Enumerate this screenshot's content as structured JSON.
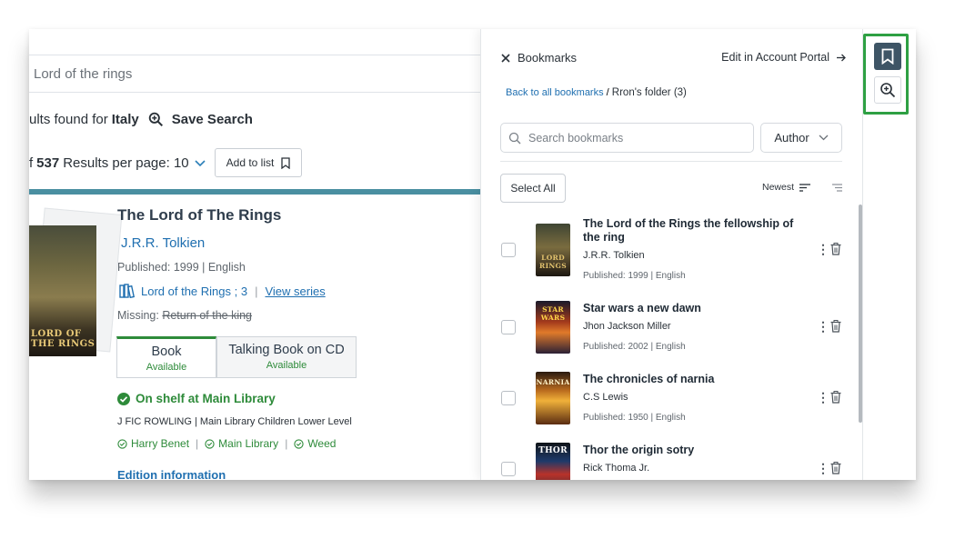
{
  "search": {
    "value": "Lord of the rings"
  },
  "results": {
    "found_prefix": "ults found for",
    "query": "Italy",
    "save_search": "Save Search",
    "count_prefix": "f",
    "count": "537",
    "per_page_label": "Results per page: 10",
    "add_to_list": "Add to list"
  },
  "record": {
    "cover_text": "LORD OF THE RINGS",
    "title": "The Lord of The Rings",
    "author": "J.R.R. Tolkien",
    "published": "Published: 1999 | English",
    "series": "Lord of the Rings ; 3",
    "view_series": "View series",
    "missing_label": "Missing:",
    "missing_title": "Return of the king",
    "formats": [
      {
        "name": "Book",
        "status": "Available"
      },
      {
        "name": "Talking Book on CD",
        "status": "Available"
      }
    ],
    "shelf": "On shelf at Main Library",
    "call_number": "J FIC ROWLING | Main Library Children Lower Level",
    "locations": [
      "Harry Benet",
      "Main Library",
      "Weed"
    ],
    "edition_info": "Edition information"
  },
  "panel": {
    "close_label": "Bookmarks",
    "edit_label": "Edit in Account Portal",
    "back_link": "Back to all bookmarks",
    "crumb_sep": "/",
    "folder": "Rron's folder (3)",
    "search_placeholder": "Search bookmarks",
    "author_filter": "Author",
    "select_all": "Select All",
    "sort_label": "Newest",
    "items": [
      {
        "title": "The Lord of the Rings the fellowship of the ring",
        "author": "J.R.R. Tolkien",
        "published": "Published: 1999 | English",
        "cover": "LORD RINGS"
      },
      {
        "title": "Star wars a new dawn",
        "author": "Jhon Jackson Miller",
        "published": "Published: 2002 | English",
        "cover": "STAR WARS"
      },
      {
        "title": "The chronicles of narnia",
        "author": "C.S Lewis",
        "published": "Published: 1950 | English",
        "cover": "NARNIA"
      },
      {
        "title": "Thor the origin sotry",
        "author": "Rick Thoma Jr.",
        "published": "",
        "cover": "THOR"
      }
    ]
  },
  "colors": {
    "teal_bar": "#4a8fa1",
    "link_blue": "#1f6fb0",
    "available_green": "#2e8b3a",
    "rail_active": "#3e5566",
    "highlight_green": "#2ea043"
  },
  "icons": [
    "search-zoom-icon",
    "bookmark-icon",
    "chevron-down-icon",
    "series-icon",
    "check-circle-icon",
    "close-icon",
    "arrow-right-icon",
    "search-icon",
    "sort-icon",
    "list-view-icon",
    "more-vertical-icon",
    "trash-icon",
    "zoom-in-icon"
  ]
}
